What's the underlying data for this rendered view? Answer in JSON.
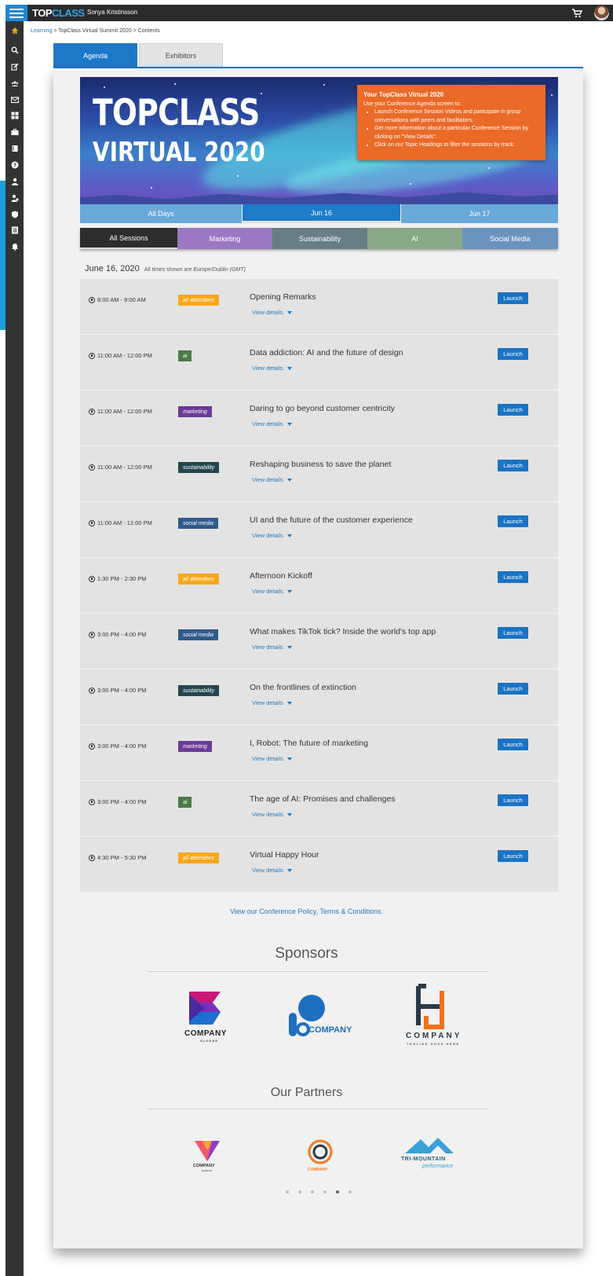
{
  "header": {
    "brand_top": "TOP",
    "brand_class": "CLASS",
    "username": "Sonya Kristinsson"
  },
  "breadcrumb": {
    "root": "Learning",
    "rest": " > TopClass Virtual Summit 2020 > Contents"
  },
  "tabs": {
    "agenda": "Agenda",
    "exhibitors": "Exhibitors"
  },
  "hero": {
    "title1": "TOPCLASS",
    "title2": "VIRTUAL 2020",
    "info_title": "Your TopClass Virtual 2020",
    "info_intro": "Use your Conference Agenda screen to:",
    "info_items": [
      "Launch Conference Session Videos and participate in group conversations with peers and facilitators.",
      "Get more information about a particular Conference Session by clicking on \"View Details\".",
      "Click on our Topic Headings to filter the sessions by track."
    ]
  },
  "days": [
    "All Days",
    "Jun 16",
    "Jun 17"
  ],
  "tracks": [
    "All Sessions",
    "Marketing",
    "Sustainability",
    "AI",
    "Social Media"
  ],
  "date": {
    "label": "June 16, 2020",
    "tz_prefix": "All times shown are ",
    "tz": "Europe/Dublin (GMT)"
  },
  "sessions": [
    {
      "time": "8:00 AM - 9:00 AM",
      "tag": "all attendees",
      "title": "Opening Remarks",
      "details": "View details",
      "launch": "Launch"
    },
    {
      "time": "11:00 AM - 12:00 PM",
      "tag": "ai",
      "title": "Data addiction: AI and the future of design",
      "details": "View details",
      "launch": "Launch"
    },
    {
      "time": "11:00 AM - 12:00 PM",
      "tag": "marketing",
      "title": "Daring to go beyond customer centricity",
      "details": "View details",
      "launch": "Launch"
    },
    {
      "time": "11:00 AM - 12:00 PM",
      "tag": "sustainability",
      "title": "Reshaping business to save the planet",
      "details": "View details",
      "launch": "Launch"
    },
    {
      "time": "11:00 AM - 12:00 PM",
      "tag": "social media",
      "title": "UI and the future of the customer experience",
      "details": "View details",
      "launch": "Launch"
    },
    {
      "time": "1:30 PM - 2:30 PM",
      "tag": "all attendees",
      "title": "Afternoon Kickoff",
      "details": "View details",
      "launch": "Launch"
    },
    {
      "time": "3:00 PM - 4:00 PM",
      "tag": "social media",
      "title": "What makes TikTok tick? Inside the world's top app",
      "details": "View details",
      "launch": "Launch"
    },
    {
      "time": "3:00 PM - 4:00 PM",
      "tag": "sustainability",
      "title": "On the frontlines of extinction",
      "details": "View details",
      "launch": "Launch"
    },
    {
      "time": "3:00 PM - 4:00 PM",
      "tag": "marketing",
      "title": "I, Robot: The future of marketing",
      "details": "View details",
      "launch": "Launch"
    },
    {
      "time": "3:00 PM - 4:00 PM",
      "tag": "ai",
      "title": "The age of AI: Promises and challenges",
      "details": "View details",
      "launch": "Launch"
    },
    {
      "time": "4:30 PM - 5:30 PM",
      "tag": "all attendees",
      "title": "Virtual Happy Hour",
      "details": "View details",
      "launch": "Launch"
    }
  ],
  "policy": {
    "prefix": "View our Conference Policy, ",
    "link": "Terms & Conditions."
  },
  "sponsors": {
    "heading": "Sponsors",
    "logos": [
      {
        "name": "COMPANY",
        "tagline": "SLOGAN"
      },
      {
        "name": "COMPANY"
      },
      {
        "name": "COMPANY",
        "tagline": "TAGLINE GOES HERE"
      }
    ]
  },
  "partners": {
    "heading": "Our Partners",
    "logos": [
      {
        "name": "COMPANY",
        "tagline": "SLOGAN"
      },
      {
        "name": "COMPANY"
      },
      {
        "name": "TRI-MOUNTAIN",
        "tagline": "performance"
      }
    ]
  },
  "carousel": {
    "count": 6,
    "active": 4
  },
  "colors": {
    "brand_blue": "#1e78c8",
    "orange": "#ea6a28",
    "tag_all": "#f7a81b",
    "tag_ai": "#4b7a46",
    "tag_marketing": "#6b3a98",
    "tag_sustainability": "#23464e",
    "tag_social": "#2e5a8c"
  }
}
